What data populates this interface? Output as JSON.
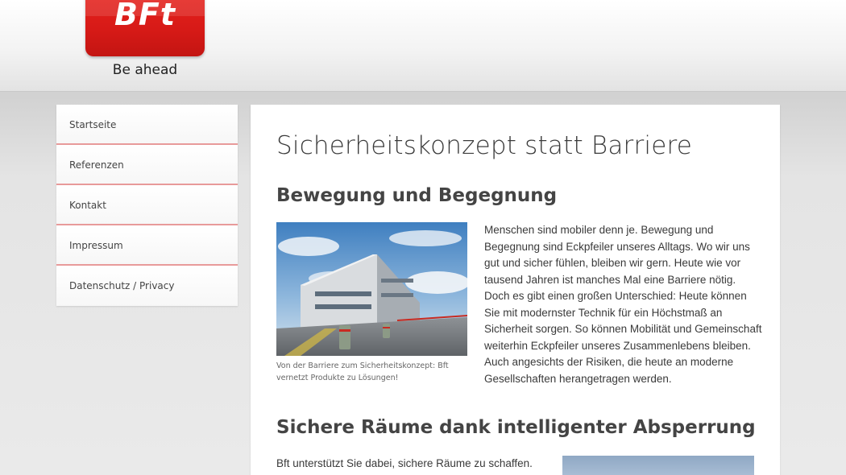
{
  "header": {
    "logo_text": "BFt",
    "tagline": "Be ahead"
  },
  "sidebar": {
    "items": [
      {
        "label": "Startseite"
      },
      {
        "label": "Referenzen"
      },
      {
        "label": "Kontakt"
      },
      {
        "label": "Impressum"
      },
      {
        "label": "Datenschutz / Privacy"
      }
    ]
  },
  "main": {
    "title": "Sicherheitskonzept statt Barriere",
    "section1": {
      "heading": "Bewegung und Begegnung",
      "caption": "Von der Barriere zum Sicherheitskonzept: Bft vernetzt Produkte zu Lösungen!",
      "text": "Menschen sind mobiler denn je. Bewegung und Begegnung sind Eckpfeiler unseres Alltags. Wo wir uns gut und sicher fühlen, bleiben wir gern. Heute wie vor tausend Jahren ist manches Mal eine Barriere nötig. Doch es gibt einen großen Unterschied: Heute können Sie mit modernster Technik für ein Höchstmaß an Sicherheit sorgen. So können Mobilität und Gemeinschaft weiterhin Eckpfeiler unseres Zusammenlebens bleiben. Auch angesichts der Risiken, die heute an moderne Gesellschaften herangetragen werden."
    },
    "section2": {
      "heading": "Sichere Räume dank intelligenter Absperrung",
      "text": "Bft unterstützt Sie dabei, sichere Räume zu schaffen."
    }
  },
  "colors": {
    "brand_red": "#d71a17",
    "nav_divider": "#e89a9a"
  }
}
